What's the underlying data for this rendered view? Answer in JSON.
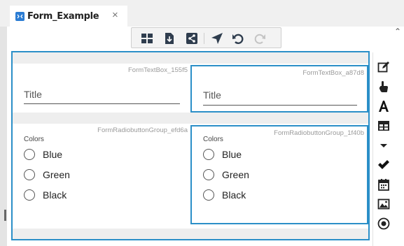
{
  "tab": {
    "title": "Form_Example",
    "close": "×"
  },
  "toolbar": {
    "icons": [
      "grid-icon",
      "download-icon",
      "share-icon",
      "navigate-icon",
      "undo-icon",
      "redo-icon"
    ]
  },
  "form": {
    "row1": [
      {
        "id": "FormTextBox_155f5",
        "label": "Title",
        "selected": false
      },
      {
        "id": "FormTextBox_a87d8",
        "label": "Title",
        "selected": true
      }
    ],
    "row2": [
      {
        "id": "FormRadiobuttonGroup_efd6a",
        "group_label": "Colors",
        "options": [
          "Blue",
          "Green",
          "Black"
        ],
        "selected": false
      },
      {
        "id": "FormRadiobuttonGroup_1f40b",
        "group_label": "Colors",
        "options": [
          "Blue",
          "Green",
          "Black"
        ],
        "selected": true
      }
    ]
  },
  "panel": {
    "icons": [
      "edit-icon",
      "pointer-icon",
      "text-icon",
      "table-icon",
      "dropdown-icon",
      "check-icon",
      "calendar-icon",
      "image-icon",
      "radio-icon"
    ]
  },
  "colors": {
    "accent": "#2b8fc8",
    "tab_icon": "#2b7cd3",
    "icon_dark": "#222222",
    "toolbar_icon": "#2f3d4e"
  }
}
